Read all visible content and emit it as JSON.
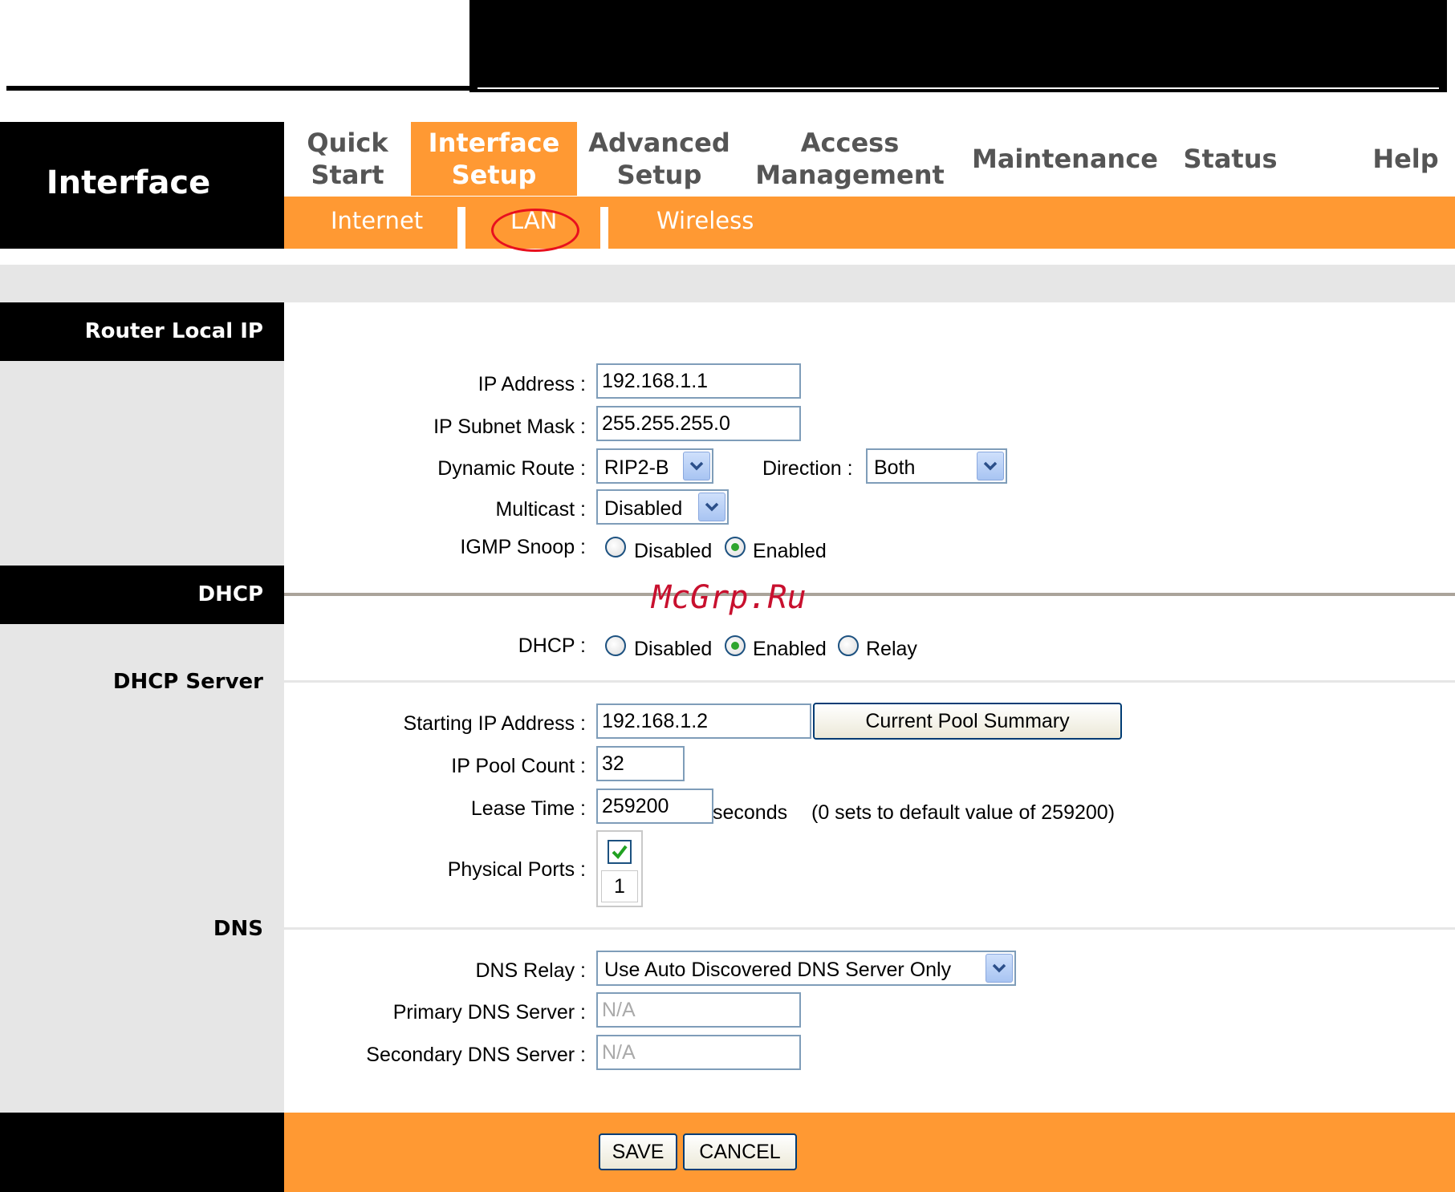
{
  "sidebar": {
    "title": "Interface"
  },
  "main_tabs": [
    {
      "label": "Quick\nStart"
    },
    {
      "label": "Interface\nSetup"
    },
    {
      "label": "Advanced\nSetup"
    },
    {
      "label": "Access\nManagement"
    },
    {
      "label": "Maintenance"
    },
    {
      "label": "Status"
    },
    {
      "label": "Help"
    }
  ],
  "sub_tabs": [
    {
      "label": "Internet"
    },
    {
      "label": "LAN"
    },
    {
      "label": "Wireless"
    }
  ],
  "sections": {
    "router_local_ip": "Router Local IP",
    "dhcp": "DHCP",
    "dhcp_server": "DHCP Server",
    "dns": "DNS"
  },
  "router": {
    "ip_address_label": "IP Address :",
    "ip_address": "192.168.1.1",
    "subnet_mask_label": "IP Subnet Mask :",
    "subnet_mask": "255.255.255.0",
    "dynamic_route_label": "Dynamic Route :",
    "dynamic_route": "RIP2-B",
    "direction_label": "Direction :",
    "direction": "Both",
    "multicast_label": "Multicast :",
    "multicast": "Disabled",
    "igmp_label": "IGMP Snoop :",
    "igmp_disabled": "Disabled",
    "igmp_enabled": "Enabled",
    "igmp_selected": "Enabled"
  },
  "dhcp": {
    "label": "DHCP :",
    "disabled": "Disabled",
    "enabled": "Enabled",
    "relay": "Relay",
    "selected": "Enabled",
    "starting_ip_label": "Starting IP Address :",
    "starting_ip": "192.168.1.2",
    "pool_summary_button": "Current Pool Summary",
    "pool_count_label": "IP Pool Count :",
    "pool_count": "32",
    "lease_time_label": "Lease Time :",
    "lease_time": "259200",
    "lease_unit": "seconds",
    "lease_note": "(0 sets to default value of 259200)",
    "ports_label": "Physical Ports :",
    "port_number": "1",
    "port_checked": true
  },
  "dns": {
    "relay_label": "DNS Relay :",
    "relay": "Use Auto Discovered DNS Server Only",
    "primary_label": "Primary DNS Server :",
    "primary": "N/A",
    "secondary_label": "Secondary DNS Server :",
    "secondary": "N/A"
  },
  "footer": {
    "save": "SAVE",
    "cancel": "CANCEL"
  },
  "watermark": "McGrp.Ru",
  "colors": {
    "accent": "#ff9933",
    "header_bg": "#000000",
    "sidebar_bg": "#e6e6e6",
    "annotation": "#e8101e"
  }
}
